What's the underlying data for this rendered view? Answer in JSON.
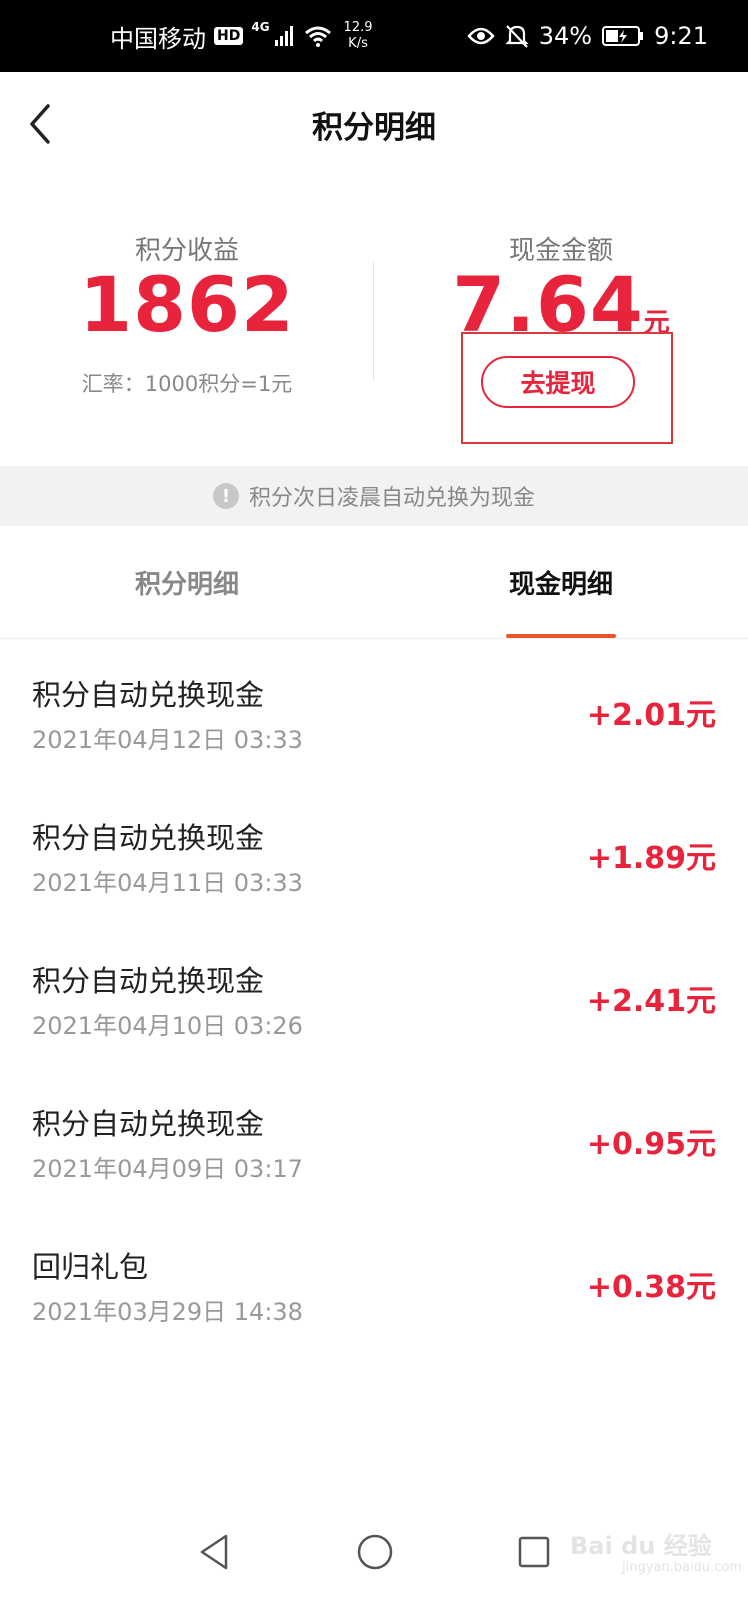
{
  "status_bar": {
    "carrier": "中国移动",
    "hd": "HD",
    "network": "4G",
    "speed_value": "12.9",
    "speed_unit": "K/s",
    "battery": "34%",
    "time": "9:21"
  },
  "header": {
    "title": "积分明细"
  },
  "summary": {
    "points_label": "积分收益",
    "points_value": "1862",
    "rate_text": "汇率：1000积分=1元",
    "cash_label": "现金金额",
    "cash_value": "7.64",
    "cash_unit": "元",
    "withdraw_label": "去提现"
  },
  "notice": {
    "icon": "!",
    "text": "积分次日凌晨自动兑换为现金"
  },
  "tabs": [
    {
      "label": "积分明细",
      "active": false
    },
    {
      "label": "现金明细",
      "active": true
    }
  ],
  "records": [
    {
      "title": "积分自动兑换现金",
      "date": "2021年04月12日 03:33",
      "amount": "+2.01元"
    },
    {
      "title": "积分自动兑换现金",
      "date": "2021年04月11日 03:33",
      "amount": "+1.89元"
    },
    {
      "title": "积分自动兑换现金",
      "date": "2021年04月10日 03:26",
      "amount": "+2.41元"
    },
    {
      "title": "积分自动兑换现金",
      "date": "2021年04月09日 03:17",
      "amount": "+0.95元"
    },
    {
      "title": "回归礼包",
      "date": "2021年03月29日 14:38",
      "amount": "+0.38元"
    }
  ],
  "watermark": {
    "text": "Bai du 经验",
    "sub": "jingyan.baidu.com"
  },
  "colors": {
    "accent_red": "#e8243c",
    "tab_underline": "#e8562a"
  }
}
